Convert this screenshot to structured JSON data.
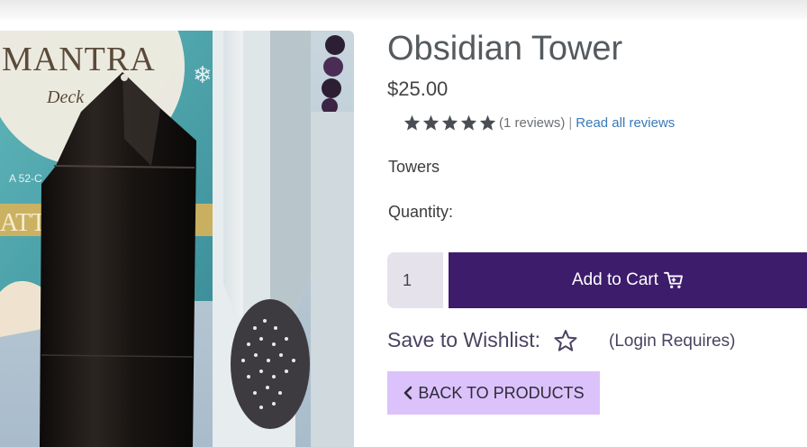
{
  "product": {
    "title": "Obsidian Tower",
    "price": "$25.00",
    "category": "Towers"
  },
  "rating": {
    "stars": 5,
    "review_count_text": "(1 reviews)",
    "separator": "|",
    "read_all_label": "Read all reviews"
  },
  "purchase": {
    "quantity_label": "Quantity:",
    "quantity_value": "1",
    "add_to_cart_label": "Add to Cart"
  },
  "wishlist": {
    "label": "Save to Wishlist:",
    "note": "(Login Requires)"
  },
  "navigation": {
    "back_label": "BACK TO PRODUCTS"
  },
  "image": {
    "card_title": "MANTRA",
    "card_subtitle": "Deck",
    "card_small_text": "A 52-C",
    "card_gold_text": "ATT"
  },
  "colors": {
    "accent_purple": "#3d1c6b",
    "back_button_bg": "#dcc2fb",
    "link_blue": "#3a7ab8",
    "qty_bg": "#e6e2ec",
    "star_gray": "#4a4d52"
  },
  "icons": {
    "rating": "star-icon",
    "cart": "shopping-cart-icon",
    "wishlist": "star-outline-icon",
    "back": "chevron-left-icon"
  }
}
